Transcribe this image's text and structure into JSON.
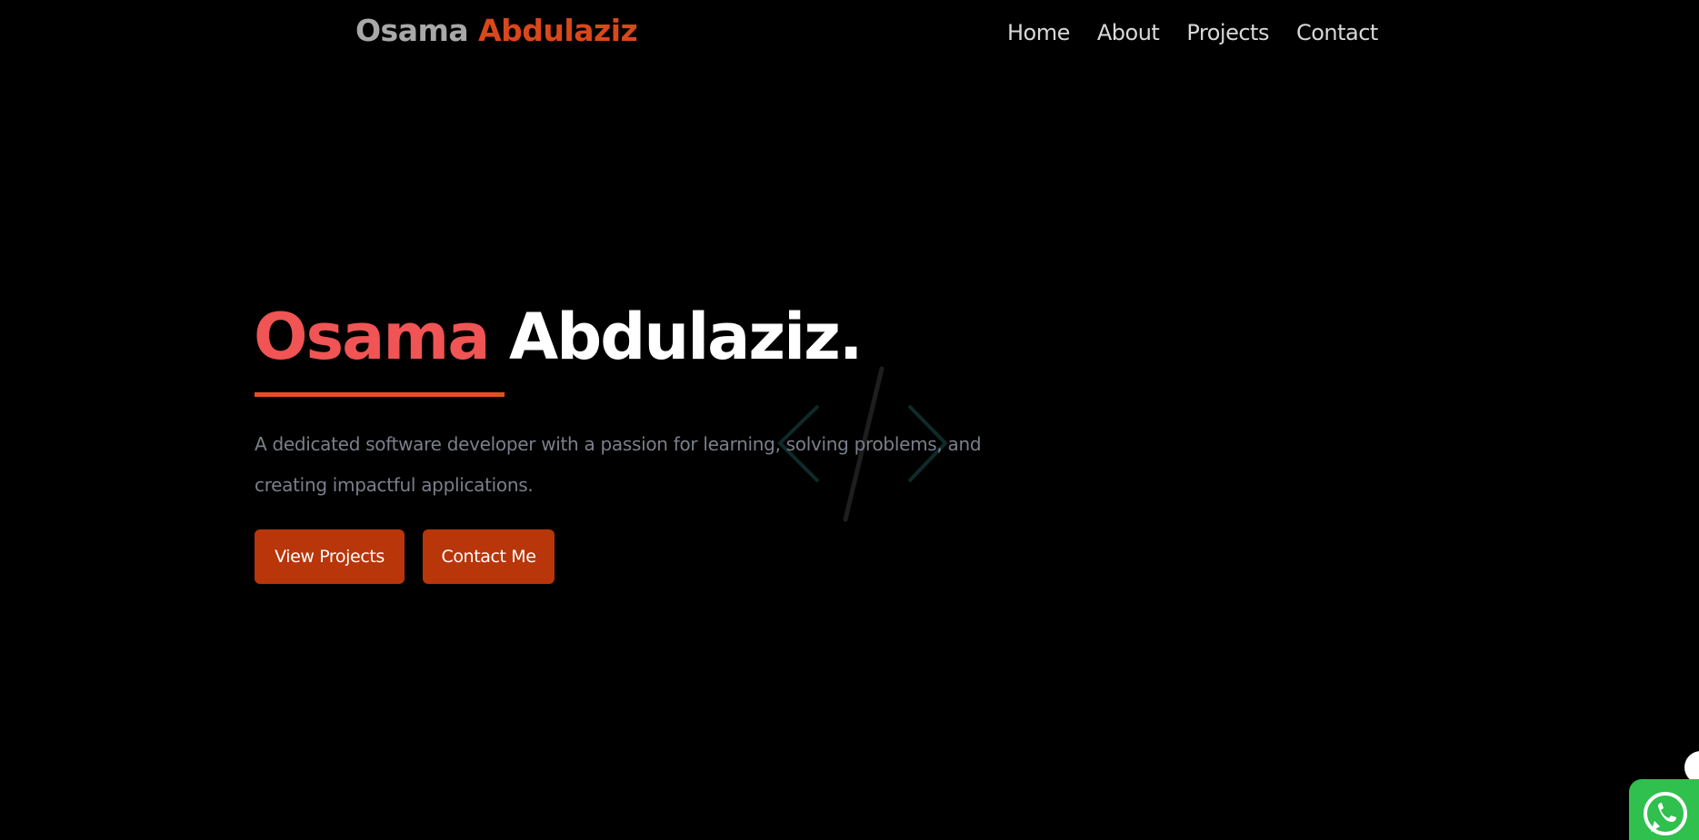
{
  "header": {
    "logo_first": "Osama",
    "logo_last": "Abdulaziz",
    "nav": {
      "home": "Home",
      "about": "About",
      "projects": "Projects",
      "contact": "Contact"
    }
  },
  "hero": {
    "title_first": "Osama",
    "title_last": "Abdulaziz.",
    "description": "A dedicated software developer with a passion for learning, solving problems, and creating impactful applications.",
    "buttons": {
      "view_projects": "View Projects",
      "contact_me": "Contact Me"
    },
    "decoration_icon": "code-brackets-icon"
  },
  "widgets": {
    "whatsapp_icon": "whatsapp-icon"
  },
  "colors": {
    "background": "#000000",
    "accent_orange": "#d9481a",
    "title_red": "#f05454",
    "button_bg": "#b8360a",
    "whatsapp_green": "#2fc04d"
  }
}
